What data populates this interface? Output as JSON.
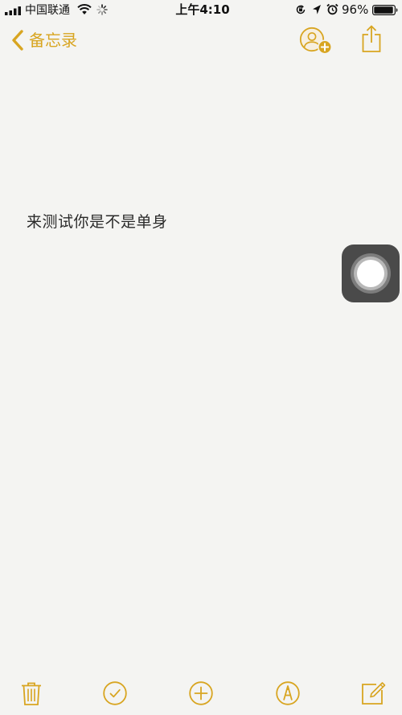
{
  "status_bar": {
    "carrier": "中国联通",
    "time": "上午4:10",
    "battery_percent": "96%",
    "battery_level": 0.96,
    "icons": [
      "signal-bars-icon",
      "wifi-icon",
      "activity-spinner-icon",
      "orientation-lock-icon",
      "location-arrow-icon",
      "alarm-clock-icon",
      "battery-icon"
    ]
  },
  "nav": {
    "back_label": "备忘录",
    "back_icon": "chevron-left-icon",
    "add_people_icon": "add-people-icon",
    "share_icon": "share-icon"
  },
  "note": {
    "body": "来测试你是不是单身"
  },
  "assistive_touch_icon": "assistive-touch-icon",
  "toolbar": {
    "icons": [
      "trash-icon",
      "checklist-icon",
      "add-icon",
      "markup-icon",
      "compose-icon"
    ]
  },
  "colors": {
    "accent": "#d8a521",
    "background": "#f4f4f2",
    "text": "#2a2a2a",
    "assistive_touch": "#4a4a4a"
  }
}
